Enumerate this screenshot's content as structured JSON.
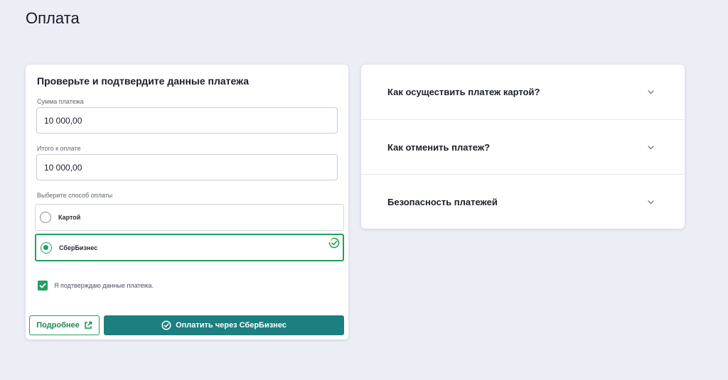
{
  "page": {
    "title": "Оплата"
  },
  "payment_form": {
    "heading": "Проверьте и подтвердите данные платежа",
    "amount": {
      "label": "Сумма платежа",
      "value": "10 000,00"
    },
    "total": {
      "label": "Итого к оплате",
      "value": "10 000,00"
    },
    "method": {
      "label": "Выберите способ оплаты",
      "options": [
        {
          "label": "Картой",
          "selected": false
        },
        {
          "label": "СберБизнес",
          "selected": true
        }
      ]
    },
    "confirm": {
      "label": "Я подтверждаю данные платежа.",
      "checked": true
    },
    "more_button": "Подробнее",
    "pay_button": "Оплатить через СберБизнес"
  },
  "faq": {
    "items": [
      {
        "question": "Как осуществить платеж картой?"
      },
      {
        "question": "Как отменить платеж?"
      },
      {
        "question": "Безопасность платежей"
      }
    ]
  },
  "colors": {
    "background": "#eceef6",
    "accent_green": "#21a060",
    "pay_button": "#1c7f80"
  },
  "icons": [
    "sber-logo-icon",
    "check-icon",
    "external-link-icon",
    "check-circle-icon",
    "chevron-down-icon"
  ]
}
